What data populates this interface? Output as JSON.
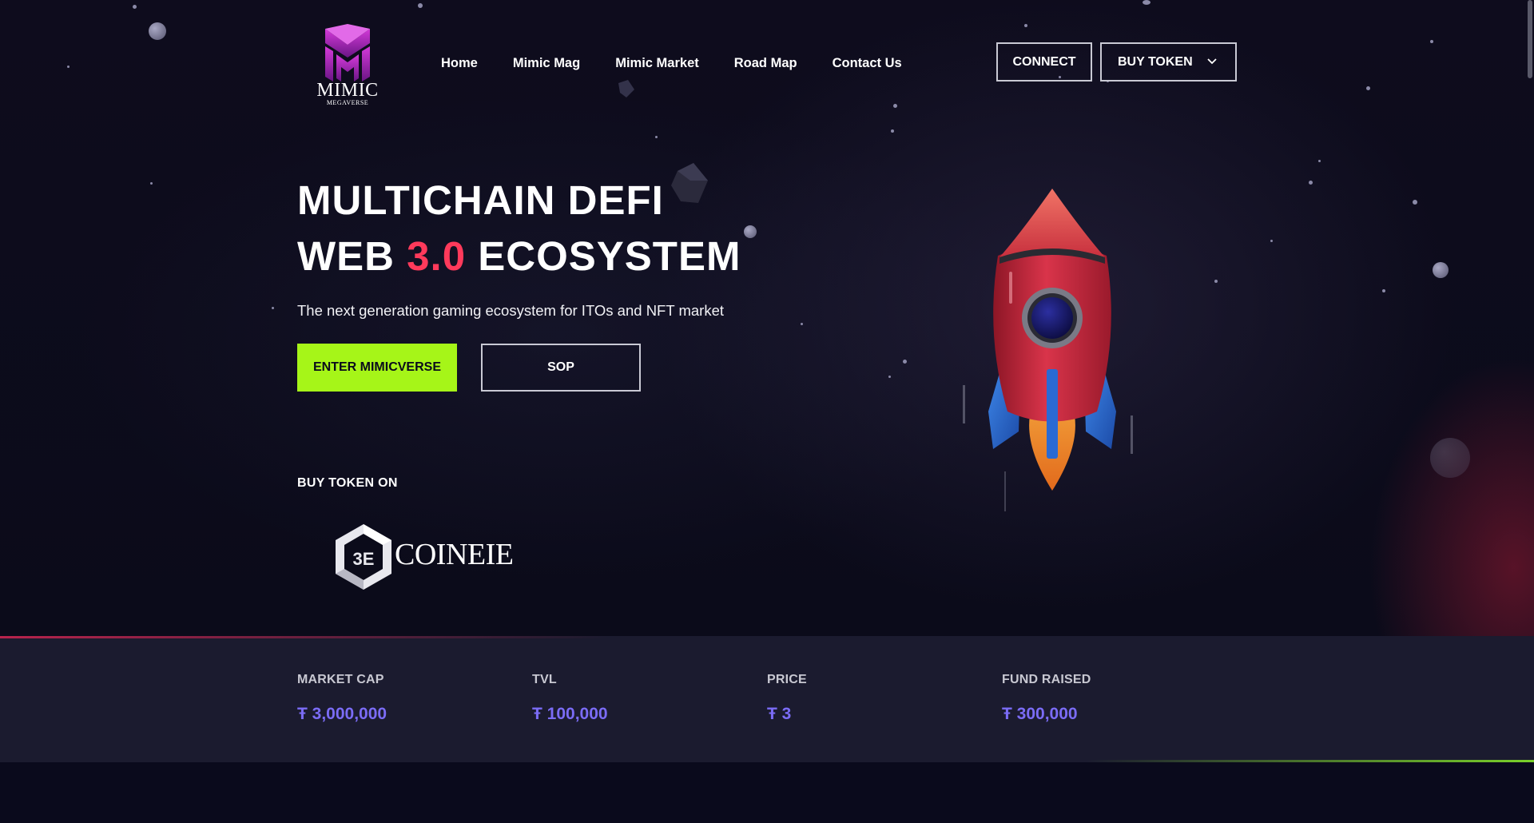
{
  "brand": {
    "name": "MIMIC",
    "tagline": "MEGAVERSE"
  },
  "nav": {
    "items": [
      {
        "label": "Home"
      },
      {
        "label": "Mimic Mag"
      },
      {
        "label": "Mimic Market"
      },
      {
        "label": "Road Map"
      },
      {
        "label": "Contact Us"
      }
    ]
  },
  "header": {
    "connect_label": "CONNECT",
    "buy_token_label": "BUY TOKEN"
  },
  "hero": {
    "title_line1": "MULTICHAIN DEFI",
    "title_line2_prefix": "WEB",
    "title_line2_accent": "3.0",
    "title_line2_suffix": "ECOSYSTEM",
    "subtitle": "The next generation gaming ecosystem for ITOs and NFT market",
    "primary_button": "ENTER MIMICVERSE",
    "secondary_button": "SOP",
    "buy_on_label": "BUY TOKEN ON",
    "exchange_name": "COINEIE",
    "exchange_mark": "3E"
  },
  "stats": [
    {
      "label": "MARKET CAP",
      "value": "Ŧ 3,000,000"
    },
    {
      "label": "TVL",
      "value": "Ŧ 100,000"
    },
    {
      "label": "PRICE",
      "value": "Ŧ 3"
    },
    {
      "label": "FUND RAISED",
      "value": "Ŧ 300,000"
    }
  ],
  "colors": {
    "accent_red": "#ff3a5b",
    "cta_green": "#a6f518",
    "stat_value": "#7b6cf6",
    "logo_purple": "#a020b0"
  },
  "icons": {
    "dropdown": "chevron-down-icon",
    "rocket": "rocket-illustration"
  }
}
